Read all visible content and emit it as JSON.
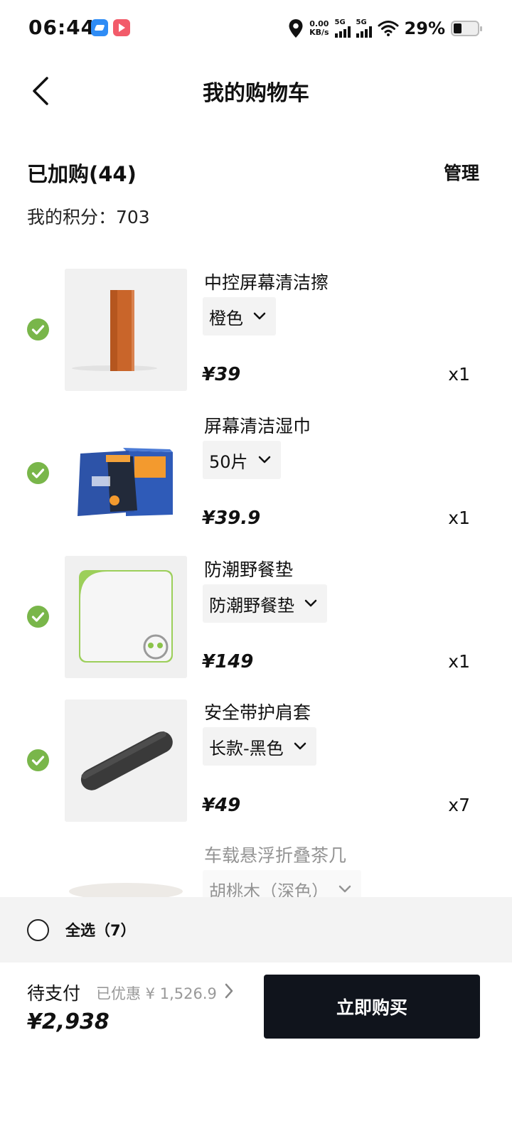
{
  "status_bar": {
    "time": "06:44",
    "net_speed_value": "0.00",
    "net_speed_unit": "KB/s",
    "signal_1_label": "5G",
    "signal_2_label": "5G",
    "battery": "29%"
  },
  "header": {
    "title": "我的购物车"
  },
  "summary": {
    "cart_count": "已加购(44)",
    "manage": "管理",
    "points": "我的积分：703"
  },
  "items": [
    {
      "name": "中控屏幕清洁擦",
      "variant": "橙色",
      "price": "¥39",
      "qty": "x1",
      "selected": true
    },
    {
      "name": "屏幕清洁湿巾",
      "variant": "50片",
      "price": "¥39.9",
      "qty": "x1",
      "selected": true
    },
    {
      "name": "防潮野餐垫",
      "variant": "防潮野餐垫",
      "price": "¥149",
      "qty": "x1",
      "selected": true
    },
    {
      "name": "安全带护肩套",
      "variant": "长款-黑色",
      "price": "¥49",
      "qty": "x7",
      "selected": true
    },
    {
      "name": "车载悬浮折叠茶几",
      "variant": "胡桃木（深色）",
      "price": "",
      "qty": "",
      "selected": false
    }
  ],
  "select_all": {
    "label": "全选（7）"
  },
  "checkout": {
    "pending_label": "待支付",
    "discount": "已优惠 ¥ 1,526.9",
    "total": "¥2,938",
    "buy_button": "立即购买"
  },
  "colors": {
    "check_green": "#79b64a",
    "button_dark": "#10141c",
    "thumb_orange": "#c9652a"
  }
}
